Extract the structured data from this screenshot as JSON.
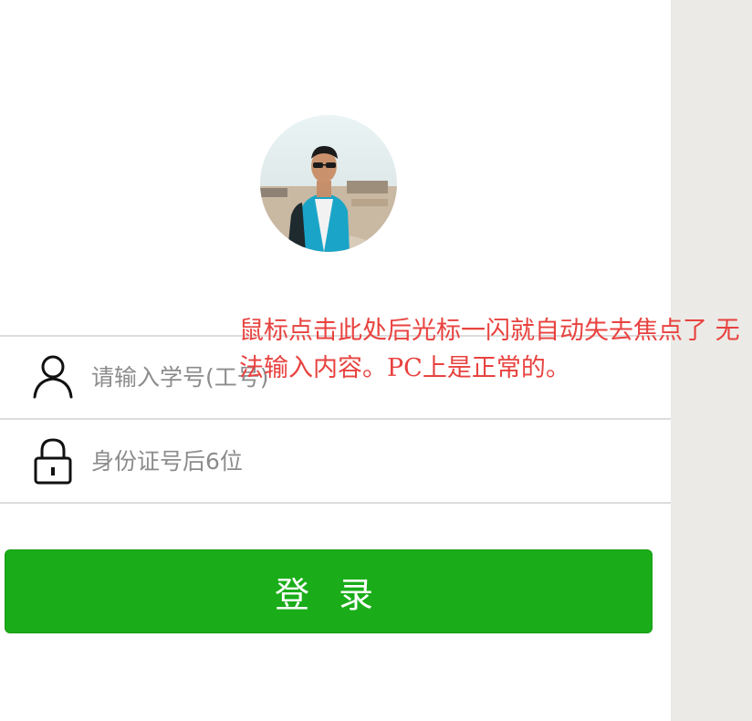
{
  "login_form": {
    "student_id_placeholder": "请输入学号(工号)",
    "password_placeholder": "身份证号后6位",
    "login_button_label": "登 录"
  },
  "annotation": {
    "text": "鼠标点击此处后光标一闪就自动失去焦点了 无法输入内容。PC上是正常的。",
    "color": "#e8423f"
  },
  "icons": {
    "user_field": "user-icon",
    "password_field": "lock-icon"
  },
  "colors": {
    "primary_button": "#1aad19",
    "side_panel": "#ebeae7",
    "divider": "#dcdcdc"
  }
}
